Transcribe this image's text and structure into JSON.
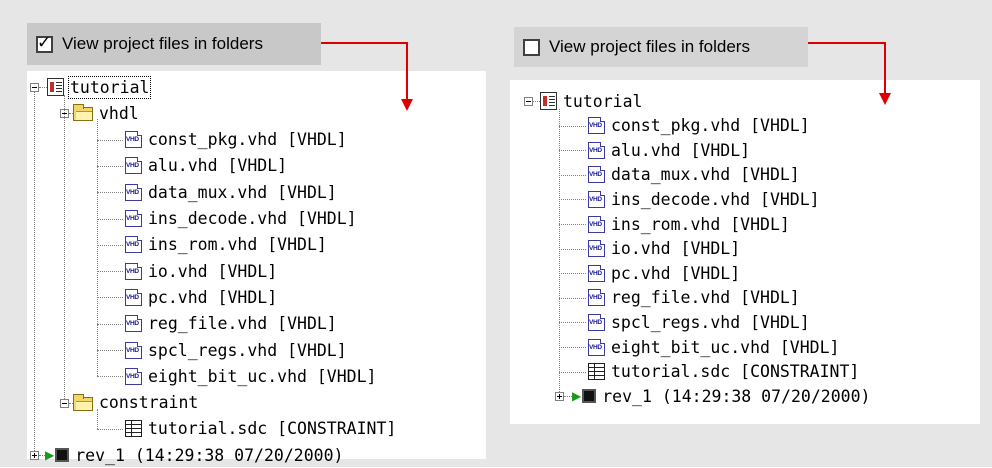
{
  "left": {
    "checkbox": {
      "label": "View project files in folders",
      "checked": true
    },
    "root": {
      "label": "tutorial"
    },
    "folders": [
      {
        "label": "vhdl",
        "files": [
          "const_pkg.vhd [VHDL]",
          "alu.vhd [VHDL]",
          "data_mux.vhd [VHDL]",
          "ins_decode.vhd [VHDL]",
          "ins_rom.vhd [VHDL]",
          "io.vhd [VHDL]",
          "pc.vhd [VHDL]",
          "reg_file.vhd [VHDL]",
          "spcl_regs.vhd [VHDL]",
          "eight_bit_uc.vhd [VHDL]"
        ]
      },
      {
        "label": "constraint",
        "files": [
          "tutorial.sdc [CONSTRAINT]"
        ]
      }
    ],
    "revision": "rev_1 (14:29:38 07/20/2000)"
  },
  "right": {
    "checkbox": {
      "label": "View project files in folders",
      "checked": false
    },
    "root": {
      "label": "tutorial"
    },
    "files": [
      "const_pkg.vhd [VHDL]",
      "alu.vhd [VHDL]",
      "data_mux.vhd [VHDL]",
      "ins_decode.vhd [VHDL]",
      "ins_rom.vhd [VHDL]",
      "io.vhd [VHDL]",
      "pc.vhd [VHDL]",
      "reg_file.vhd [VHDL]",
      "spcl_regs.vhd [VHDL]",
      "eight_bit_uc.vhd [VHDL]"
    ],
    "constraint_file": "tutorial.sdc [CONSTRAINT]",
    "revision": "rev_1 (14:29:38 07/20/2000)"
  },
  "icons": {
    "vhd_icon_text": "VHD",
    "checkmark": "✓",
    "arrow_color": "#dd0000"
  }
}
